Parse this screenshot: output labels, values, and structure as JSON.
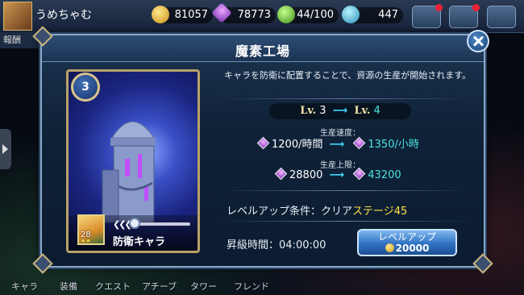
{
  "topbar": {
    "player_name": "うめちゃむ",
    "gold": "81057",
    "gems": "78773",
    "stamina": "44/100",
    "diamonds": "447",
    "reward_tab": "報酬"
  },
  "bottom_nav": [
    "キャラ",
    "装備",
    "クエスト",
    "アチーブ",
    "タワー",
    "フレンド"
  ],
  "dialog": {
    "title": "魔素工場",
    "description": "キャラを防衛に配置することで、資源の生産が開始されます。",
    "level": {
      "label": "Lv.",
      "current": "3",
      "next": "4"
    },
    "production_speed": {
      "label": "生産速度：",
      "current": "1200/時間",
      "next": "1350/小時"
    },
    "production_limit": {
      "label": "生産上限：",
      "current": "28800",
      "next": "43200"
    },
    "condition": {
      "label": "レベルアップ条件：",
      "prefix": "クリア",
      "value": "ステージ45"
    },
    "upgrade_time": {
      "label": "昇級時間：",
      "value": "04:00:00"
    },
    "levelup_button": {
      "label": "レベルアップ",
      "cost": "20000"
    },
    "card": {
      "badge_level": "3",
      "chara_level": "28",
      "role": "防衛キャラ"
    }
  }
}
